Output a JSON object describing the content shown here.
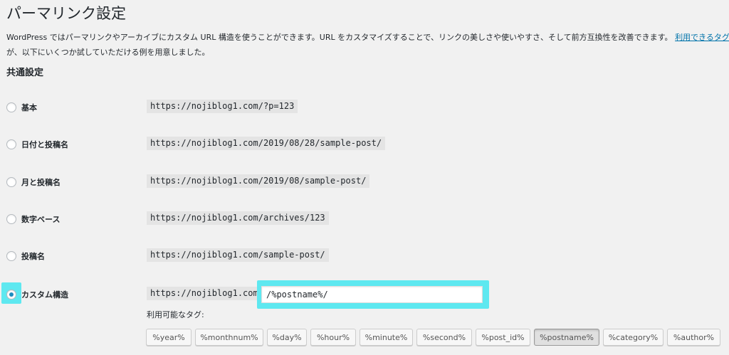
{
  "page": {
    "title": "パーマリンク設定",
    "intro_line1": "WordPress ではパーマリンクやアーカイブにカスタム URL 構造を使うことができます。URL をカスタマイズすることで、リンクの美しさや使いやすさ、そして前方互換性を改善できます。",
    "intro_link": "利用できるタグはた",
    "intro_line2": "が、以下にいくつか試していただける例を用意しました。"
  },
  "section": {
    "title": "共通設定"
  },
  "options": [
    {
      "label": "基本",
      "example": "https://nojiblog1.com/?p=123",
      "checked": false
    },
    {
      "label": "日付と投稿名",
      "example": "https://nojiblog1.com/2019/08/28/sample-post/",
      "checked": false
    },
    {
      "label": "月と投稿名",
      "example": "https://nojiblog1.com/2019/08/sample-post/",
      "checked": false
    },
    {
      "label": "数字ベース",
      "example": "https://nojiblog1.com/archives/123",
      "checked": false
    },
    {
      "label": "投稿名",
      "example": "https://nojiblog1.com/sample-post/",
      "checked": false
    },
    {
      "label": "カスタム構造",
      "example": "https://nojiblog1.com",
      "checked": true
    }
  ],
  "custom": {
    "value": "/%postname%/",
    "tags_label": "利用可能なタグ:",
    "tags": [
      "%year%",
      "%monthnum%",
      "%day%",
      "%hour%",
      "%minute%",
      "%second%",
      "%post_id%",
      "%postname%",
      "%category%",
      "%author%"
    ],
    "active_tag": "%postname%"
  },
  "colors": {
    "link": "#0073aa",
    "highlight": "#5ee8f0",
    "radio_checked": "#1e8cbe"
  }
}
